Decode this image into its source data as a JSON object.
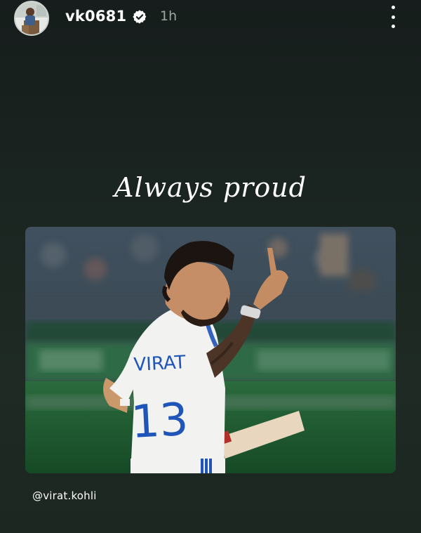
{
  "story": {
    "author": {
      "username": "vk0681",
      "verified": true,
      "time_ago": "1h",
      "avatar_icon": "profile-avatar"
    },
    "menu_icon": "more-vertical-icon",
    "caption": "Always proud",
    "mention": "@virat.kohli",
    "photo": {
      "jersey_name": "VIRAT",
      "jersey_number": "13",
      "colors": {
        "jersey": "#f2f2f0",
        "jersey_text": "#1f54b8",
        "field": "#1f6a37",
        "crowd": "#3b4a57"
      }
    }
  }
}
